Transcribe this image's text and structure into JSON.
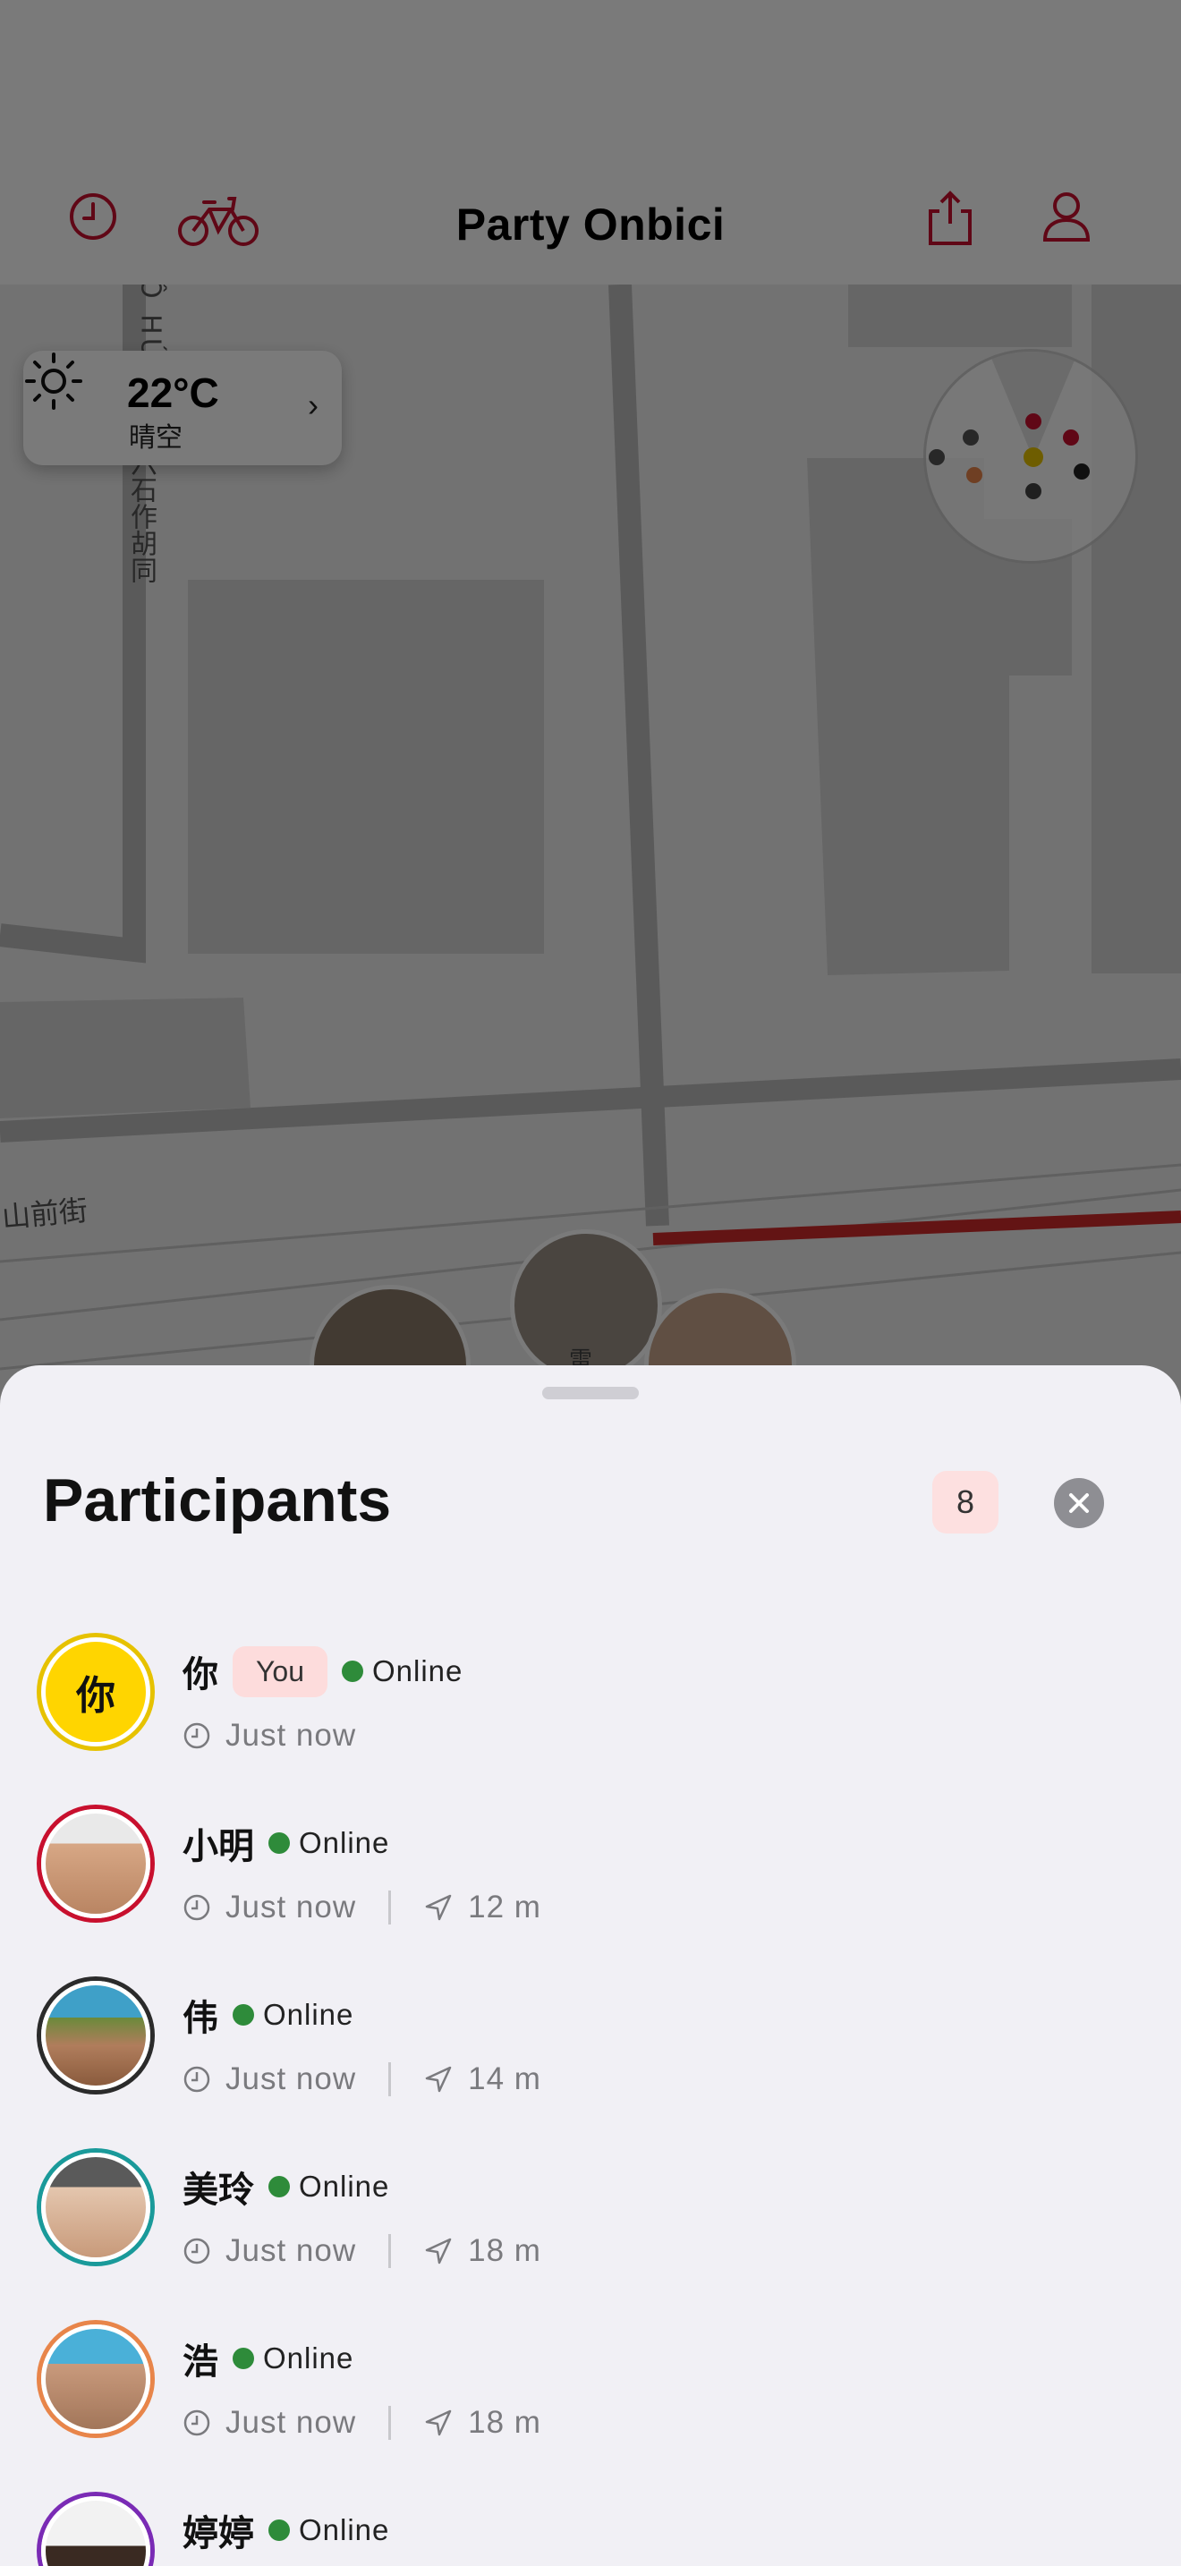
{
  "header": {
    "title": "Party Onbici",
    "icons": [
      "history-icon",
      "bike-icon",
      "share-icon",
      "profile-icon"
    ],
    "accent_color": "#c8102e"
  },
  "map": {
    "street_labels": [
      "六石作胡同",
      "山前街"
    ],
    "partial_labels": [
      "Ô HÚ",
      "雷"
    ]
  },
  "weather": {
    "temperature": "22°C",
    "condition": "晴空",
    "icon": "sun-icon"
  },
  "sheet": {
    "title": "Participants",
    "count": "8",
    "close_icon": "close-icon"
  },
  "participants": [
    {
      "name": "你",
      "avatar_text": "你",
      "is_you": true,
      "you_label": "You",
      "status": "Online",
      "last_seen": "Just now",
      "distance": "",
      "ring_color": "#e6c200"
    },
    {
      "name": "小明",
      "is_you": false,
      "status": "Online",
      "last_seen": "Just now",
      "distance": "12 m",
      "ring_color": "#c8102e"
    },
    {
      "name": "伟",
      "is_you": false,
      "status": "Online",
      "last_seen": "Just now",
      "distance": "14 m",
      "ring_color": "#2b2b2b"
    },
    {
      "name": "美玲",
      "is_you": false,
      "status": "Online",
      "last_seen": "Just now",
      "distance": "18 m",
      "ring_color": "#1a9a9a"
    },
    {
      "name": "浩",
      "is_you": false,
      "status": "Online",
      "last_seen": "Just now",
      "distance": "18 m",
      "ring_color": "#e8854a"
    },
    {
      "name": "婷婷",
      "is_you": false,
      "status": "Online",
      "last_seen": "",
      "distance": "",
      "ring_color": "#7a2bb5"
    }
  ]
}
